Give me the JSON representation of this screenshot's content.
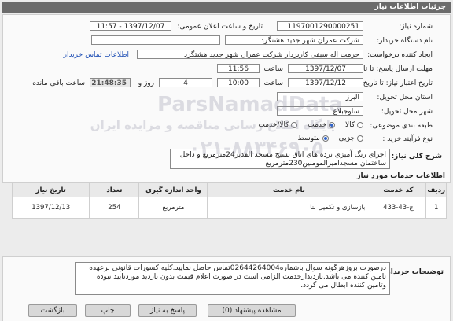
{
  "window_title": "جزئیات اطلاعات نیاز",
  "fields": {
    "need_number_label": "شماره نیاز:",
    "need_number": "1197001290000251",
    "announce_label": "تاریخ و ساعت اعلان عمومی:",
    "announce_value": "1397/12/07 - 11:57",
    "buyer_label": "نام دستگاه خریدار:",
    "buyer_value": "شرکت عمران شهر جدید هشتگرد",
    "creator_label": "ایجاد کننده درخواست:",
    "creator_value": "حرمت اله  سیفی کاربردار شرکت عمران شهر جدید هشتگرد",
    "contact_link": "اطلاعات تماس خریدار",
    "send_deadline_label": "مهلت ارسال پاسخ: تا تاریخ:",
    "send_date": "1397/12/07",
    "time_label": "ساعت",
    "send_time": "11:56",
    "validity_label": "تاریخ اعتبار نیاز: تا تاریخ:",
    "validity_date": "1397/12/12",
    "validity_time": "10:00",
    "days": "4",
    "day_and_label": "روز و",
    "remaining_time": "21:48:35",
    "remaining_label": "ساعت باقی مانده",
    "province_label": "استان محل تحویل:",
    "province_value": "البرز",
    "city_label": "شهر محل تحویل:",
    "city_value": "ساوجبلاغ",
    "category_label": "طبقه بندی موضوعی:",
    "category_options": [
      "کالا",
      "خدمت",
      "کالا/خدمت"
    ],
    "process_label": "نوع فرآیند خرید :",
    "process_options": [
      "جزیی",
      "متوسط"
    ],
    "description_label": "شرح کلی نیاز:",
    "description_value": "اجرای رنگ آمیزی نرده های اتاق بسیج مسجد القدیر24مترمربع و داخل ساختمان مسجدامیرالمومنین230مترمربع"
  },
  "services_title": "اطلاعات خدمات مورد نیاز",
  "table": {
    "headers": [
      "ردیف",
      "کد خدمت",
      "نام خدمت",
      "واحد اندازه گیری",
      "تعداد",
      "تاریخ نیاز"
    ],
    "rows": [
      [
        "1",
        "ج-43-433",
        "بازسازی و تکمیل بنا",
        "مترمربع",
        "254",
        "1397/12/13"
      ]
    ]
  },
  "buyer_notes_label": "توضیحات خریدار:",
  "buyer_notes": "درصورت بروزهرگونه سوال باشماره02644264004تماس حاصل نمایید.کلیه کسورات قانونی برعهده تامین کننده می باشد.بازدیدازخدمت الزامی است در صورت اعلام قیمت بدون بازدید موردتایید نبوده وتامین کننده ابطال می گردد.",
  "buttons": {
    "back": "بازگشت",
    "print": "چاپ",
    "reply": "پاسخ به نیاز",
    "view_bids": "مشاهده پیشنهاد (0)"
  },
  "watermark": {
    "brand": "ParsNamadData",
    "line1": "پایگاه اطلاع رسانی مناقصه و مزایده ایران",
    "phone": "۰۲۱-۸۸۳۴۶۹۰۵"
  },
  "colors": {
    "titlebar": "#6b6b6b",
    "link": "#1f4fb5",
    "radio_on": "#2e62c9"
  }
}
